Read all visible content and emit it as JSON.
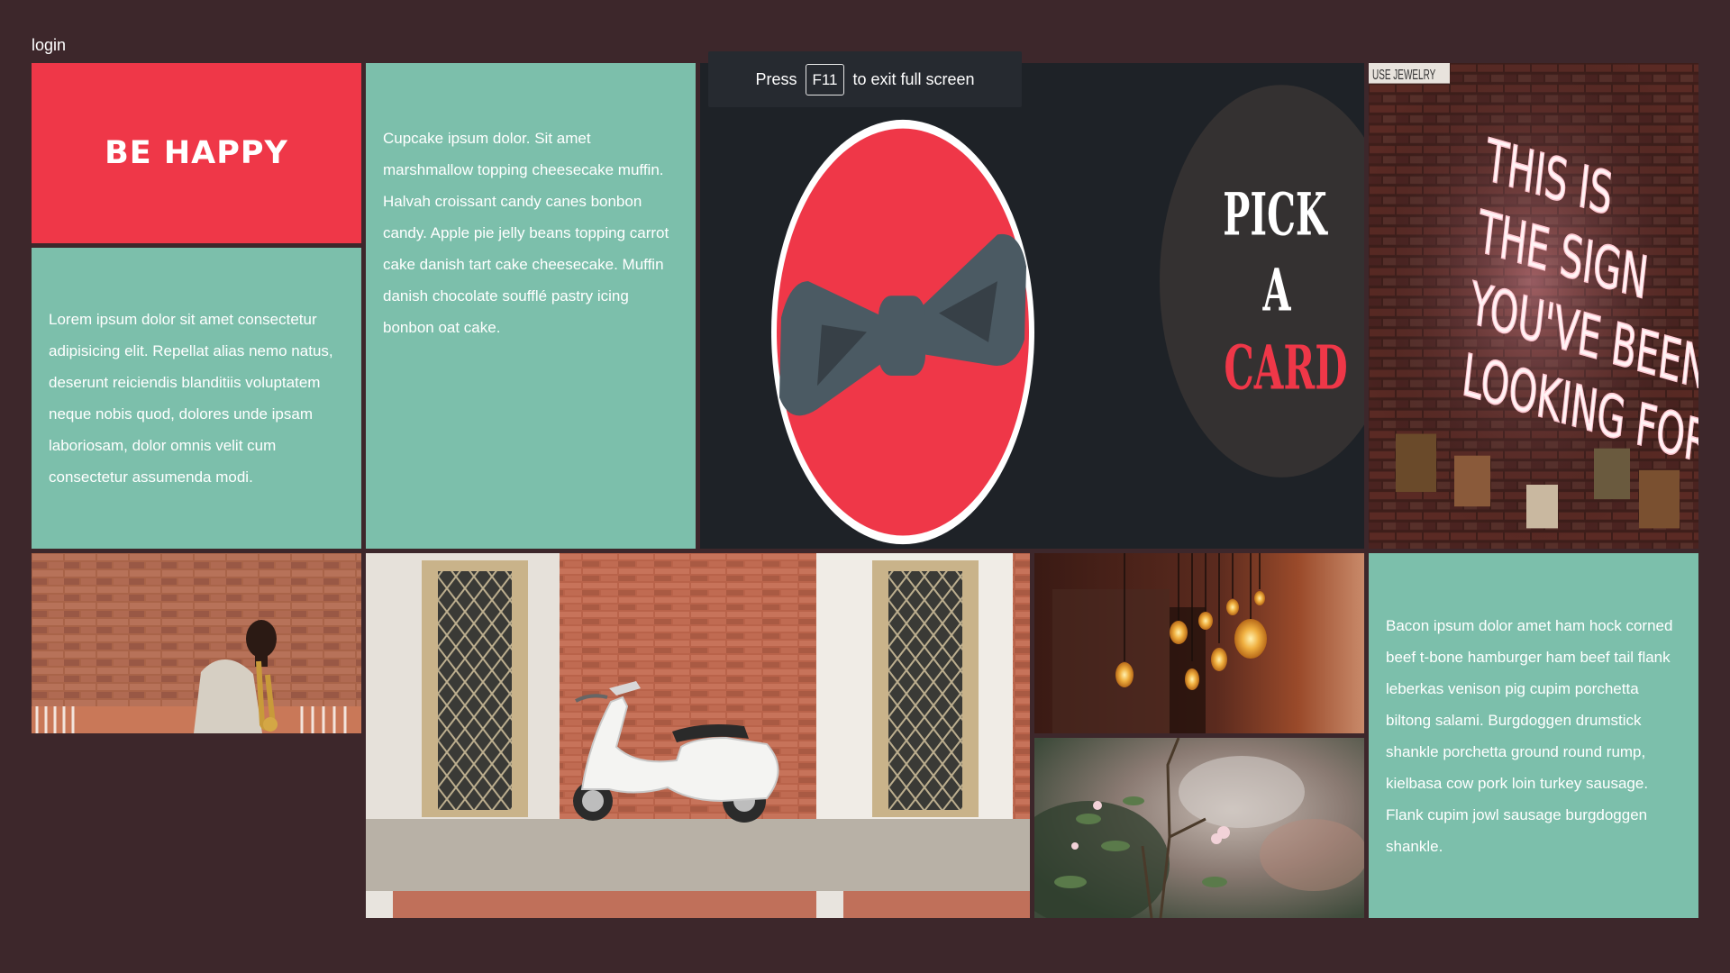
{
  "header": {
    "login_label": "login"
  },
  "tiles": {
    "happy_title": "BE HAPPY",
    "lorem_text": "Lorem ipsum dolor sit amet consectetur adipisicing elit. Repellat alias nemo natus, deserunt reiciendis blanditiis voluptatem neque nobis quod, dolores unde ipsam laboriosam, dolor omnis velit cum consectetur assumenda modi.",
    "cupcake_text": "Cupcake ipsum dolor. Sit amet marshmallow topping cheesecake muffin. Halvah croissant candy canes bonbon candy. Apple pie jelly beans topping carrot cake danish tart cake cheesecake. Muffin danish chocolate soufflé pastry icing bonbon oat cake.",
    "bacon_text": "Bacon ipsum dolor amet ham hock corned beef t-bone hamburger ham beef tail flank leberkas venison pig cupim porchetta biltong salami. Burgdoggen drumstick shankle porchetta ground round rump, kielbasa cow pork loin turkey sausage. Flank cupim jowl sausage burgdoggen shankle.",
    "pick_card": {
      "line1": "PICK",
      "line2": "A",
      "line3": "CARD"
    },
    "neon_sign": {
      "line1": "THIS IS",
      "line2": "THE SIGN",
      "line3": "YOU'VE BEEN",
      "line4": "LOOKING FOR"
    },
    "shop_sign": "USE JEWELRY"
  },
  "fullscreen_toast": {
    "press": "Press",
    "key": "F11",
    "message": "to exit full screen"
  },
  "colors": {
    "background": "#3d272b",
    "red": "#ef3748",
    "teal": "#7cbfab",
    "dark": "#1e2227"
  }
}
